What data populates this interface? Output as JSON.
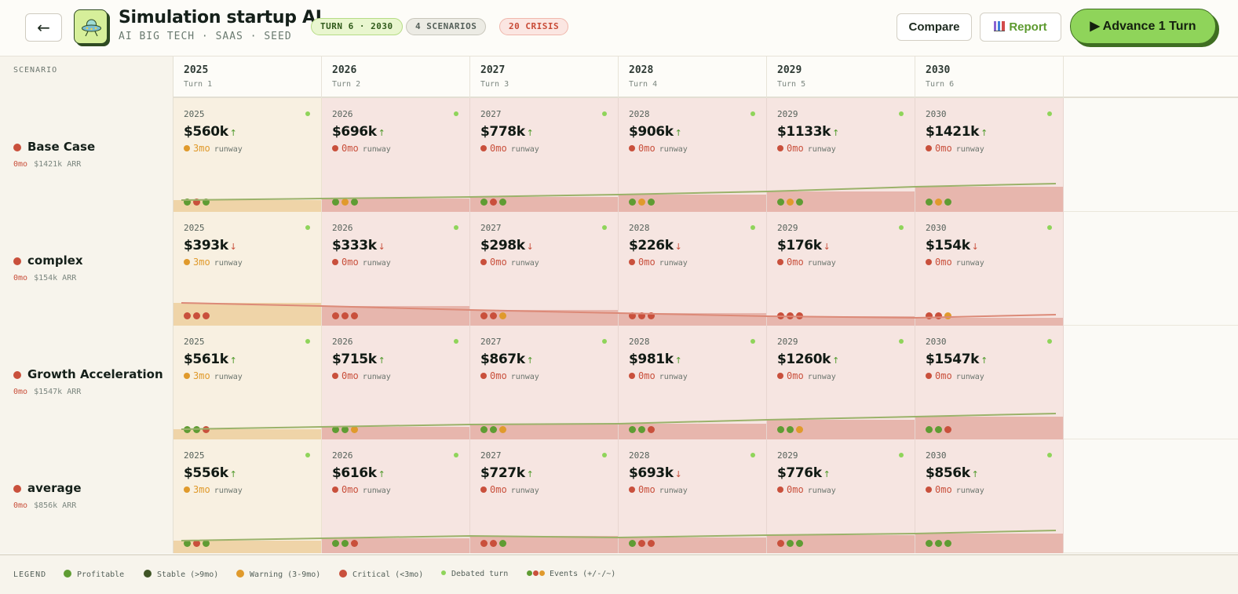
{
  "header": {
    "back_label": "←",
    "title": "Simulation startup AI",
    "subtitle": "AI BIG TECH · SAAS · SEED",
    "turn_pill": "TURN 6 · 2030",
    "scenarios_pill": "4 SCENARIOS",
    "crisis_pill": "20 CRISIS",
    "compare_label": "Compare",
    "report_label": "Report",
    "advance_label": "▶ Advance 1 Turn"
  },
  "grid": {
    "scenario_label": "SCENARIO",
    "years": [
      {
        "year": "2025",
        "turn": "Turn 1"
      },
      {
        "year": "2026",
        "turn": "Turn 2"
      },
      {
        "year": "2027",
        "turn": "Turn 3"
      },
      {
        "year": "2028",
        "turn": "Turn 4"
      },
      {
        "year": "2029",
        "turn": "Turn 5"
      },
      {
        "year": "2030",
        "turn": "Turn 6"
      }
    ],
    "runway_word": "runway"
  },
  "colors": {
    "profitable": "#5f9c33",
    "stable": "#3f5425",
    "warning": "#e09a2c",
    "critical": "#c9503c",
    "debated": "#8fd45a"
  },
  "scenarios": [
    {
      "name": "Base Case",
      "runway": "0mo",
      "arr": "$1421k ARR",
      "trend": "up",
      "cells": [
        {
          "year": "2025",
          "arr": "$560k",
          "dir": "up",
          "runway": "3mo",
          "status": "warning",
          "events": [
            "profitable",
            "critical",
            "profitable"
          ],
          "level": 0.1
        },
        {
          "year": "2026",
          "arr": "$696k",
          "dir": "up",
          "runway": "0mo",
          "status": "critical",
          "events": [
            "profitable",
            "warning",
            "profitable"
          ],
          "level": 0.12
        },
        {
          "year": "2027",
          "arr": "$778k",
          "dir": "up",
          "runway": "0mo",
          "status": "critical",
          "events": [
            "profitable",
            "critical",
            "profitable"
          ],
          "level": 0.13
        },
        {
          "year": "2028",
          "arr": "$906k",
          "dir": "up",
          "runway": "0mo",
          "status": "critical",
          "events": [
            "profitable",
            "warning",
            "profitable"
          ],
          "level": 0.15
        },
        {
          "year": "2029",
          "arr": "$1133k",
          "dir": "up",
          "runway": "0mo",
          "status": "critical",
          "events": [
            "profitable",
            "warning",
            "profitable"
          ],
          "level": 0.18
        },
        {
          "year": "2030",
          "arr": "$1421k",
          "dir": "up",
          "runway": "0mo",
          "status": "critical",
          "events": [
            "profitable",
            "warning",
            "profitable"
          ],
          "level": 0.22
        }
      ]
    },
    {
      "name": "complex",
      "runway": "0mo",
      "arr": "$154k ARR",
      "trend": "down",
      "cells": [
        {
          "year": "2025",
          "arr": "$393k",
          "dir": "down",
          "runway": "3mo",
          "status": "warning",
          "events": [
            "critical",
            "critical",
            "critical"
          ],
          "level": 0.2
        },
        {
          "year": "2026",
          "arr": "$333k",
          "dir": "down",
          "runway": "0mo",
          "status": "critical",
          "events": [
            "critical",
            "critical",
            "critical"
          ],
          "level": 0.17
        },
        {
          "year": "2027",
          "arr": "$298k",
          "dir": "down",
          "runway": "0mo",
          "status": "critical",
          "events": [
            "critical",
            "critical",
            "warning"
          ],
          "level": 0.14
        },
        {
          "year": "2028",
          "arr": "$226k",
          "dir": "down",
          "runway": "0mo",
          "status": "critical",
          "events": [
            "critical",
            "critical",
            "critical"
          ],
          "level": 0.11
        },
        {
          "year": "2029",
          "arr": "$176k",
          "dir": "down",
          "runway": "0mo",
          "status": "critical",
          "events": [
            "critical",
            "critical",
            "critical"
          ],
          "level": 0.08
        },
        {
          "year": "2030",
          "arr": "$154k",
          "dir": "down",
          "runway": "0mo",
          "status": "critical",
          "events": [
            "critical",
            "critical",
            "warning"
          ],
          "level": 0.07
        }
      ]
    },
    {
      "name": "Growth Acceleration",
      "runway": "0mo",
      "arr": "$1547k ARR",
      "trend": "up",
      "cells": [
        {
          "year": "2025",
          "arr": "$561k",
          "dir": "up",
          "runway": "3mo",
          "status": "warning",
          "events": [
            "profitable",
            "profitable",
            "critical"
          ],
          "level": 0.09
        },
        {
          "year": "2026",
          "arr": "$715k",
          "dir": "up",
          "runway": "0mo",
          "status": "critical",
          "events": [
            "profitable",
            "profitable",
            "warning"
          ],
          "level": 0.11
        },
        {
          "year": "2027",
          "arr": "$867k",
          "dir": "up",
          "runway": "0mo",
          "status": "critical",
          "events": [
            "profitable",
            "profitable",
            "warning"
          ],
          "level": 0.13
        },
        {
          "year": "2028",
          "arr": "$981k",
          "dir": "up",
          "runway": "0mo",
          "status": "critical",
          "events": [
            "profitable",
            "profitable",
            "critical"
          ],
          "level": 0.14
        },
        {
          "year": "2029",
          "arr": "$1260k",
          "dir": "up",
          "runway": "0mo",
          "status": "critical",
          "events": [
            "profitable",
            "profitable",
            "warning"
          ],
          "level": 0.17
        },
        {
          "year": "2030",
          "arr": "$1547k",
          "dir": "up",
          "runway": "0mo",
          "status": "critical",
          "events": [
            "profitable",
            "profitable",
            "critical"
          ],
          "level": 0.2
        }
      ]
    },
    {
      "name": "average",
      "runway": "0mo",
      "arr": "$856k ARR",
      "trend": "up",
      "cells": [
        {
          "year": "2025",
          "arr": "$556k",
          "dir": "up",
          "runway": "3mo",
          "status": "warning",
          "events": [
            "profitable",
            "critical",
            "profitable"
          ],
          "level": 0.11
        },
        {
          "year": "2026",
          "arr": "$616k",
          "dir": "up",
          "runway": "0mo",
          "status": "critical",
          "events": [
            "profitable",
            "profitable",
            "critical"
          ],
          "level": 0.13
        },
        {
          "year": "2027",
          "arr": "$727k",
          "dir": "up",
          "runway": "0mo",
          "status": "critical",
          "events": [
            "critical",
            "critical",
            "profitable"
          ],
          "level": 0.15
        },
        {
          "year": "2028",
          "arr": "$693k",
          "dir": "down",
          "runway": "0mo",
          "status": "critical",
          "events": [
            "profitable",
            "critical",
            "critical"
          ],
          "level": 0.14
        },
        {
          "year": "2029",
          "arr": "$776k",
          "dir": "up",
          "runway": "0mo",
          "status": "critical",
          "events": [
            "critical",
            "profitable",
            "profitable"
          ],
          "level": 0.16
        },
        {
          "year": "2030",
          "arr": "$856k",
          "dir": "up",
          "runway": "0mo",
          "status": "critical",
          "events": [
            "profitable",
            "profitable",
            "profitable"
          ],
          "level": 0.17
        }
      ]
    }
  ],
  "legend": {
    "title": "LEGEND",
    "profitable": "Profitable",
    "stable": "Stable (>9mo)",
    "warning": "Warning (3-9mo)",
    "critical": "Critical (<3mo)",
    "debated": "Debated turn",
    "events": "Events (+/-/~)"
  }
}
